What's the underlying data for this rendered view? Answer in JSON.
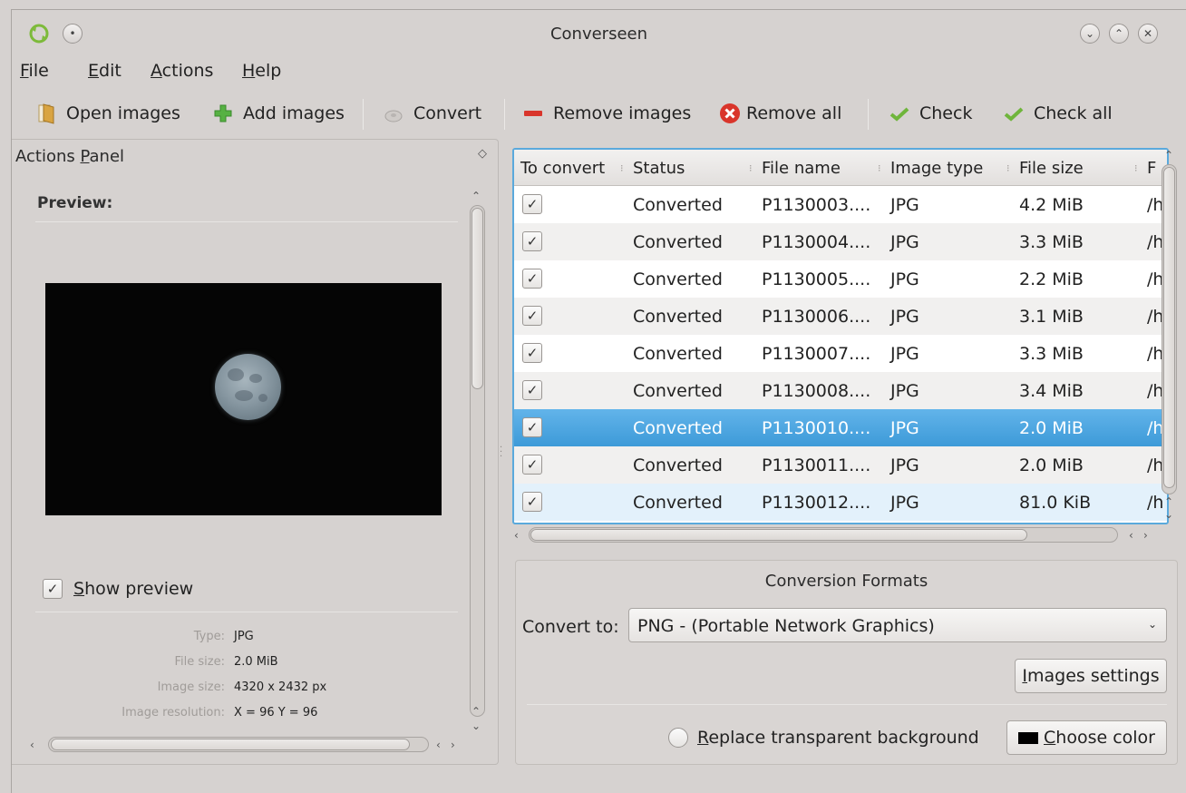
{
  "window": {
    "title": "Converseen",
    "buttons": [
      "minimize",
      "maximize",
      "close"
    ]
  },
  "menu": {
    "items": [
      {
        "label": "File",
        "mnemonic": "F",
        "rest": "ile"
      },
      {
        "label": "Edit",
        "mnemonic": "E",
        "rest": "dit"
      },
      {
        "label": "Actions",
        "mnemonic": "A",
        "rest": "ctions"
      },
      {
        "label": "Help",
        "mnemonic": "H",
        "rest": "elp"
      }
    ]
  },
  "toolbar": {
    "open_images": "Open images",
    "add_images": "Add images",
    "convert": "Convert",
    "remove_images": "Remove images",
    "remove_all": "Remove all",
    "check": "Check",
    "check_all": "Check all"
  },
  "actions_panel": {
    "title_pre": "Actions ",
    "title_mnemonic": "P",
    "title_post": "anel",
    "preview_label": "Preview:",
    "show_preview_mnemonic": "S",
    "show_preview_rest": "how preview",
    "show_preview_checked": true,
    "info": {
      "type_key": "Type:",
      "type_val": "JPG",
      "size_key": "File size:",
      "size_val": "2.0 MiB",
      "dim_key": "Image size:",
      "dim_val": "4320 x 2432 px",
      "res_key": "Image resolution:",
      "res_val": "X = 96 Y = 96"
    }
  },
  "table": {
    "headers": [
      "To convert",
      "Status",
      "File name",
      "Image type",
      "File size",
      "F"
    ],
    "rows": [
      {
        "status": "Converted",
        "name": "P1130003....",
        "type": "JPG",
        "size": "4.2 MiB",
        "path": "/h"
      },
      {
        "status": "Converted",
        "name": "P1130004....",
        "type": "JPG",
        "size": "3.3 MiB",
        "path": "/h"
      },
      {
        "status": "Converted",
        "name": "P1130005....",
        "type": "JPG",
        "size": "2.2 MiB",
        "path": "/h"
      },
      {
        "status": "Converted",
        "name": "P1130006....",
        "type": "JPG",
        "size": "3.1 MiB",
        "path": "/h"
      },
      {
        "status": "Converted",
        "name": "P1130007....",
        "type": "JPG",
        "size": "3.3 MiB",
        "path": "/h"
      },
      {
        "status": "Converted",
        "name": "P1130008....",
        "type": "JPG",
        "size": "3.4 MiB",
        "path": "/h"
      },
      {
        "status": "Converted",
        "name": "P1130010....",
        "type": "JPG",
        "size": "2.0 MiB",
        "path": "/h"
      },
      {
        "status": "Converted",
        "name": "P1130011....",
        "type": "JPG",
        "size": "2.0 MiB",
        "path": "/h"
      },
      {
        "status": "Converted",
        "name": "P1130012....",
        "type": "JPG",
        "size": "81.0 KiB",
        "path": "/h"
      }
    ],
    "selected_row": 6
  },
  "formats": {
    "title": "Conversion Formats",
    "convert_to_label": "Convert to:",
    "selected_format": "PNG - (Portable Network Graphics)",
    "images_settings_mnemonic": "I",
    "images_settings_rest": "mages settings",
    "replace_pre": "",
    "replace_mnemonic": "R",
    "replace_rest": "eplace transparent background",
    "choose_color_mnemonic": "C",
    "choose_color_rest": "hoose color"
  },
  "colors": {
    "accent": "#3d9ad8",
    "window_bg": "#d6d2d0",
    "remove_red": "#d9352b",
    "add_green": "#4caf3c"
  }
}
